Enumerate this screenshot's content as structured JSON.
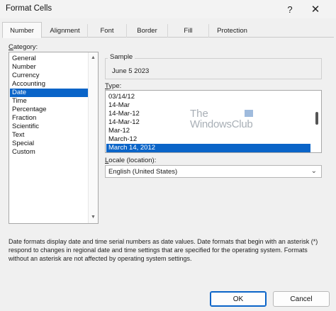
{
  "window": {
    "title": "Format Cells",
    "help_glyph": "?",
    "close_glyph": "✕"
  },
  "tabs": [
    {
      "label": "Number",
      "active": true
    },
    {
      "label": "Alignment",
      "active": false
    },
    {
      "label": "Font",
      "active": false
    },
    {
      "label": "Border",
      "active": false
    },
    {
      "label": "Fill",
      "active": false
    },
    {
      "label": "Protection",
      "active": false
    }
  ],
  "category": {
    "label_prefix": "C",
    "label_rest": "ategory:",
    "items": [
      {
        "label": "General"
      },
      {
        "label": "Number"
      },
      {
        "label": "Currency"
      },
      {
        "label": "Accounting"
      },
      {
        "label": "Date",
        "selected": true
      },
      {
        "label": "Time"
      },
      {
        "label": "Percentage"
      },
      {
        "label": "Fraction"
      },
      {
        "label": "Scientific"
      },
      {
        "label": "Text"
      },
      {
        "label": "Special"
      },
      {
        "label": "Custom"
      }
    ],
    "scroll_up_glyph": "▲",
    "scroll_down_glyph": "▼"
  },
  "sample": {
    "legend": "Sample",
    "value": "June 5 2023"
  },
  "type": {
    "label_prefix": "T",
    "label_rest": "ype:",
    "items": [
      {
        "label": "03/14/12"
      },
      {
        "label": "14-Mar"
      },
      {
        "label": "14-Mar-12"
      },
      {
        "label": "14-Mar-12"
      },
      {
        "label": "Mar-12"
      },
      {
        "label": "March-12"
      },
      {
        "label": "March 14, 2012",
        "selected": true
      }
    ]
  },
  "watermark": {
    "line1": "The",
    "line2": "WindowsClub"
  },
  "locale": {
    "label_prefix": "L",
    "label_rest": "ocale (location):",
    "value": "English (United States)",
    "chevron_glyph": "⌄"
  },
  "description": "Date formats display date and time serial numbers as date values.  Date formats that begin with an asterisk (*) respond to changes in regional date and time settings that are specified for the operating system. Formats without an asterisk are not affected by operating system settings.",
  "buttons": {
    "ok": "OK",
    "cancel": "Cancel"
  },
  "colors": {
    "selection": "#0a64c8",
    "dialog_bg": "#f0f0f0"
  }
}
